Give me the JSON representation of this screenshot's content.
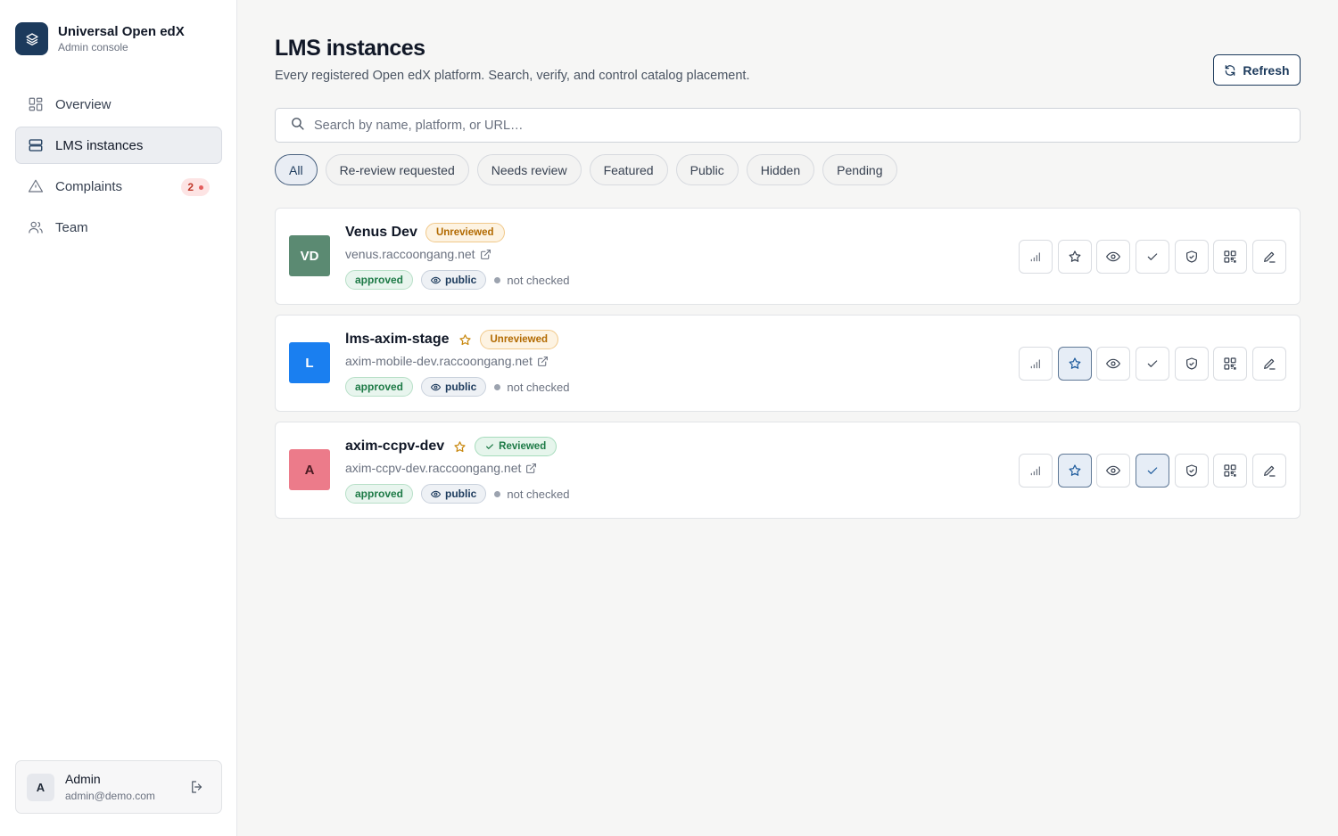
{
  "brand": {
    "title": "Universal Open edX",
    "subtitle": "Admin console"
  },
  "nav": {
    "items": [
      {
        "label": "Overview",
        "icon": "grid-icon",
        "active": false
      },
      {
        "label": "LMS instances",
        "icon": "server-icon",
        "active": true
      },
      {
        "label": "Complaints",
        "icon": "warning-icon",
        "active": false,
        "badge": "2"
      },
      {
        "label": "Team",
        "icon": "users-icon",
        "active": false
      }
    ]
  },
  "user": {
    "initial": "A",
    "name": "Admin",
    "email": "admin@demo.com"
  },
  "page": {
    "title": "LMS instances",
    "subtitle": "Every registered Open edX platform. Search, verify, and control catalog placement.",
    "refresh_label": "Refresh"
  },
  "search": {
    "placeholder": "Search by name, platform, or URL…",
    "value": ""
  },
  "filters": [
    "All",
    "Re-review requested",
    "Needs review",
    "Featured",
    "Public",
    "Hidden",
    "Pending"
  ],
  "active_filter": "All",
  "instances": [
    {
      "initials": "VD",
      "avatar_color": "#5b8a72",
      "name": "Venus Dev",
      "featured": false,
      "status": "Unreviewed",
      "status_type": "unreviewed",
      "url": "venus.raccoongang.net",
      "approval": "approved",
      "visibility": "public",
      "check": "not checked",
      "actions": {
        "featured": false,
        "verified": false
      }
    },
    {
      "initials": "L",
      "avatar_color": "#1a7ff0",
      "name": "lms-axim-stage",
      "featured": true,
      "status": "Unreviewed",
      "status_type": "unreviewed",
      "url": "axim-mobile-dev.raccoongang.net",
      "approval": "approved",
      "visibility": "public",
      "check": "not checked",
      "actions": {
        "featured": true,
        "verified": false
      }
    },
    {
      "initials": "A",
      "avatar_color": "#ec7b8a",
      "name": "axim-ccpv-dev",
      "featured": true,
      "status": "Reviewed",
      "status_type": "reviewed",
      "url": "axim-ccpv-dev.raccoongang.net",
      "approval": "approved",
      "visibility": "public",
      "check": "not checked",
      "actions": {
        "featured": true,
        "verified": true
      }
    }
  ],
  "colors": {
    "accent": "#1c3a5c",
    "warning": "#b26a00",
    "success": "#1d7a46"
  }
}
